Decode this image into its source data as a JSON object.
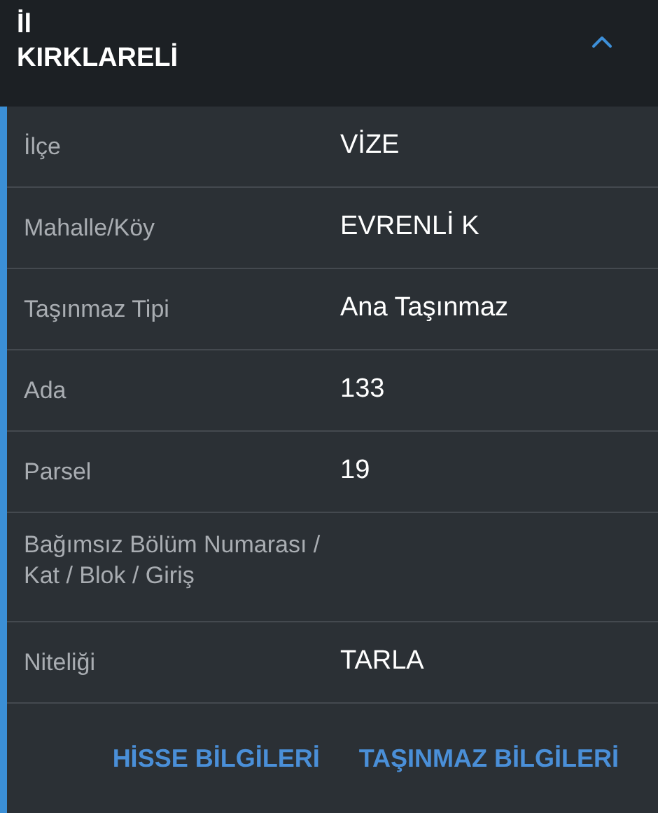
{
  "header": {
    "label": "İl",
    "value": "KIRKLARELİ",
    "expanded": true
  },
  "rows": [
    {
      "label": "İlçe",
      "value": "VİZE"
    },
    {
      "label": "Mahalle/Köy",
      "value": "EVRENLİ K"
    },
    {
      "label": "Taşınmaz Tipi",
      "value": "Ana Taşınmaz"
    },
    {
      "label": "Ada",
      "value": "133"
    },
    {
      "label": "Parsel",
      "value": "19"
    },
    {
      "label": "Bağımsız Bölüm Numarası / Kat / Blok / Giriş",
      "value": ""
    },
    {
      "label": "Niteliği",
      "value": "TARLA"
    }
  ],
  "buttons": [
    "HİSSE BİLGİLERİ",
    "TAŞINMAZ BİLGİLERİ"
  ]
}
